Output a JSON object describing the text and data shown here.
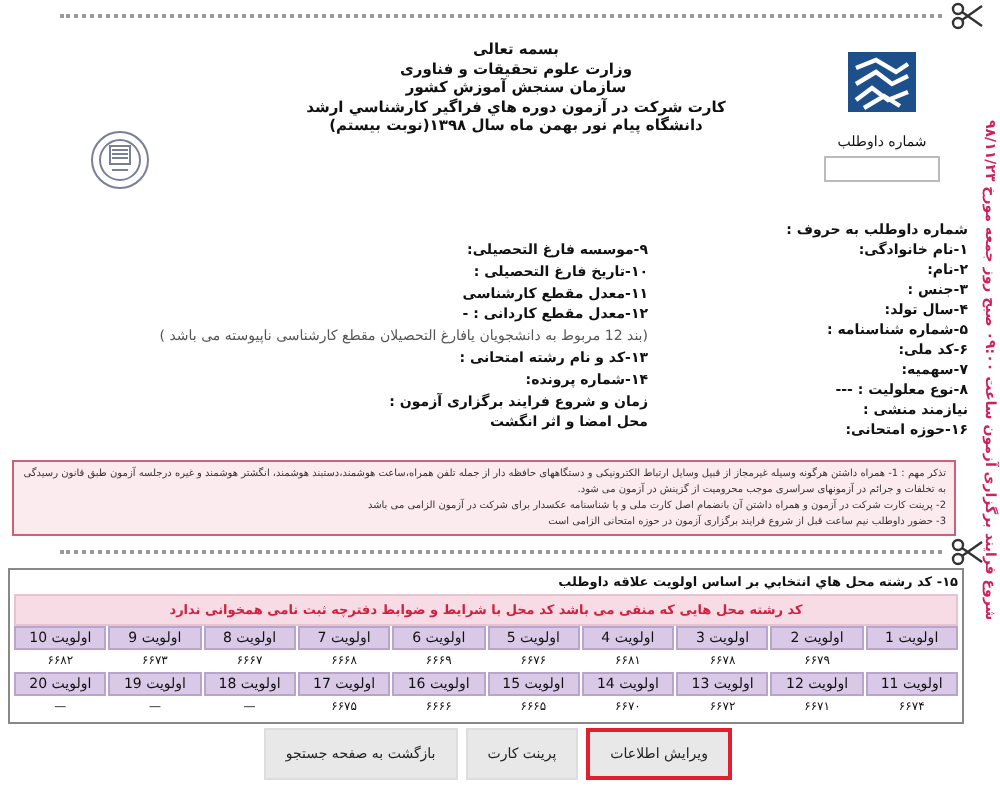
{
  "side_note": "شروع فرایند برگزاری آزمون ساعت ۰۹:۰۰ صبح روز جمعه مورخ ۹۸/۱۱/۲۳",
  "header": {
    "lines": [
      "بسمه تعالی",
      "وزارت علوم تحقیقات و فناوری",
      "سازمان سنجش آموزش کشور",
      "کارت شرکت در آزمون دوره هاي فراگير كارشناسي ارشد",
      "دانشگاه پیام نور بهمن ماه سال ۱۳۹۸(نوبت بیستم)"
    ]
  },
  "candidate_number": {
    "label": "شماره داوطلب"
  },
  "fields_right": [
    "شماره داوطلب به حروف :",
    "۱-نام خانوادگی:",
    "۲-نام:",
    "۳-جنس :",
    "۴-سال تولد:",
    "۵-شماره شناسنامه :",
    "۶-کد ملی:",
    "۷-سهمیه:",
    "۸-نوع معلولیت : ---",
    "نیازمند منشی :",
    "۱۶-حوزه امتحانی:"
  ],
  "fields_middle": [
    "۹-موسسه فارغ التحصیلی:",
    "۱۰-تاریخ فارغ التحصیلی :",
    "۱۱-معدل مقطع کارشناسی",
    "۱۲-معدل مقطع کاردانی : -",
    "(بند 12 مربوط به دانشجویان یافارغ التحصیلان مقطع کارشناسی ناپیوسته می باشد )",
    "۱۳-کد و نام رشته امتحانی :",
    "۱۴-شماره پرونده:",
    "زمان و شروع فرایند برگزاری آزمون :",
    "محل امضا و اثر انگشت"
  ],
  "note": {
    "lines": [
      "تذکر مهم : 1- همراه داشتن هرگونه وسیله غیرمجاز از قبیل وسایل ارتباط الکترونیکی و دستگاههای حافظه دار از جمله تلفن همراه،ساعت هوشمند،دستبند هوشمند، انگشتر هوشمند و غیره درجلسه آزمون طبق قانون رسیدگی به تخلفات و جرائم در آزمونهای سراسری موجب محرومیت از گزینش در آزمون می شود.",
      "2- پرینت کارت شرکت در آزمون و همراه داشتن آن بانضمام اصل کارت ملی و یا شناسنامه عکسدار برای شرکت در آزمون الزامی می باشد",
      "3- حضور داوطلب نیم ساعت قبل از شروع فرایند برگزاری آزمون در حوزه امتحانی الزامی است"
    ]
  },
  "priorities": {
    "title": "۱۵- کد رشته محل هاي انتخابي بر اساس اولويت علاقه داوطلب",
    "warning": "کد رشته محل هایی که منفی می باشد کد محل با شرایط و ضوابط دفترچه ثبت نامی همخوانی ندارد",
    "rows": [
      [
        {
          "label": "اولویت 1"
        },
        {
          "label": "اولویت 2",
          "value": "۶۶۷۹"
        },
        {
          "label": "اولویت 3",
          "value": "۶۶۷۸"
        },
        {
          "label": "اولویت 4",
          "value": "۶۶۸۱"
        },
        {
          "label": "اولویت 5",
          "value": "۶۶۷۶"
        },
        {
          "label": "اولویت 6",
          "value": "۶۶۶۹"
        },
        {
          "label": "اولویت 7",
          "value": "۶۶۶۸"
        },
        {
          "label": "اولویت 8",
          "value": "۶۶۶۷"
        },
        {
          "label": "اولویت 9",
          "value": "۶۶۷۳"
        },
        {
          "label": "اولویت 10",
          "value": "۶۶۸۲"
        }
      ],
      [
        {
          "label": "اولویت 11",
          "value": "۶۶۷۴"
        },
        {
          "label": "اولویت 12",
          "value": "۶۶۷۱"
        },
        {
          "label": "اولویت 13",
          "value": "۶۶۷۲"
        },
        {
          "label": "اولویت 14",
          "value": "۶۶۷۰"
        },
        {
          "label": "اولویت 15",
          "value": "۶۶۶۵"
        },
        {
          "label": "اولویت 16",
          "value": "۶۶۶۶"
        },
        {
          "label": "اولویت 17",
          "value": "۶۶۷۵"
        },
        {
          "label": "اولویت 18",
          "value": "—"
        },
        {
          "label": "اولویت 19",
          "value": "—"
        },
        {
          "label": "اولویت 20",
          "value": "—"
        }
      ]
    ]
  },
  "buttons": [
    {
      "label": "ویرایش اطلاعات",
      "highlighted": true
    },
    {
      "label": "پرینت کارت",
      "highlighted": false
    },
    {
      "label": "بازگشت به صفحه جستجو",
      "highlighted": false
    }
  ]
}
